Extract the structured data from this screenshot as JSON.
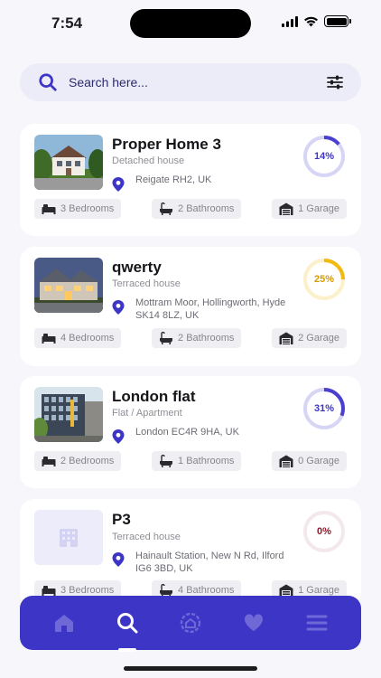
{
  "status_bar": {
    "time": "7:54"
  },
  "search": {
    "placeholder": "Search here..."
  },
  "colors": {
    "accent": "#3d35c6",
    "card_bg": "#ffffff",
    "page_bg": "#f6f6fb"
  },
  "properties": [
    {
      "title": "Proper Home 3",
      "type": "Detached house",
      "address": "Reigate RH2, UK",
      "progress_label": "14%",
      "progress": 0.14,
      "ring_color": "#4a3fd0",
      "bedrooms": "3 Bedrooms",
      "bathrooms": "2 Bathrooms",
      "garage": "1 Garage",
      "thumb": "house-photo"
    },
    {
      "title": "qwerty",
      "type": "Terraced house",
      "address": "Mottram Moor, Hollingworth, Hyde SK14 8LZ, UK",
      "progress_label": "25%",
      "progress": 0.25,
      "ring_color": "#f2b90f",
      "bedrooms": "4 Bedrooms",
      "bathrooms": "2 Bathrooms",
      "garage": "2 Garage",
      "thumb": "house-photo-dusk"
    },
    {
      "title": "London flat",
      "type": "Flat / Apartment",
      "address": "London EC4R 9HA, UK",
      "progress_label": "31%",
      "progress": 0.31,
      "ring_color": "#4a3fd0",
      "bedrooms": "2 Bedrooms",
      "bathrooms": "1 Bathrooms",
      "garage": "0 Garage",
      "thumb": "apartment-photo"
    },
    {
      "title": "P3",
      "type": "Terraced house",
      "address": "Hainault Station, New N Rd, Ilford IG6 3BD, UK",
      "progress_label": "0%",
      "progress": 0,
      "ring_color": "#c99aa4",
      "bedrooms": "3 Bedrooms",
      "bathrooms": "4 Bathrooms",
      "garage": "1 Garage",
      "thumb": "placeholder-building-icon"
    }
  ],
  "tab_bar": {
    "items": [
      "home-icon",
      "search-icon",
      "compass-home-icon",
      "heart-icon",
      "menu-icon"
    ],
    "active": "search-icon"
  }
}
